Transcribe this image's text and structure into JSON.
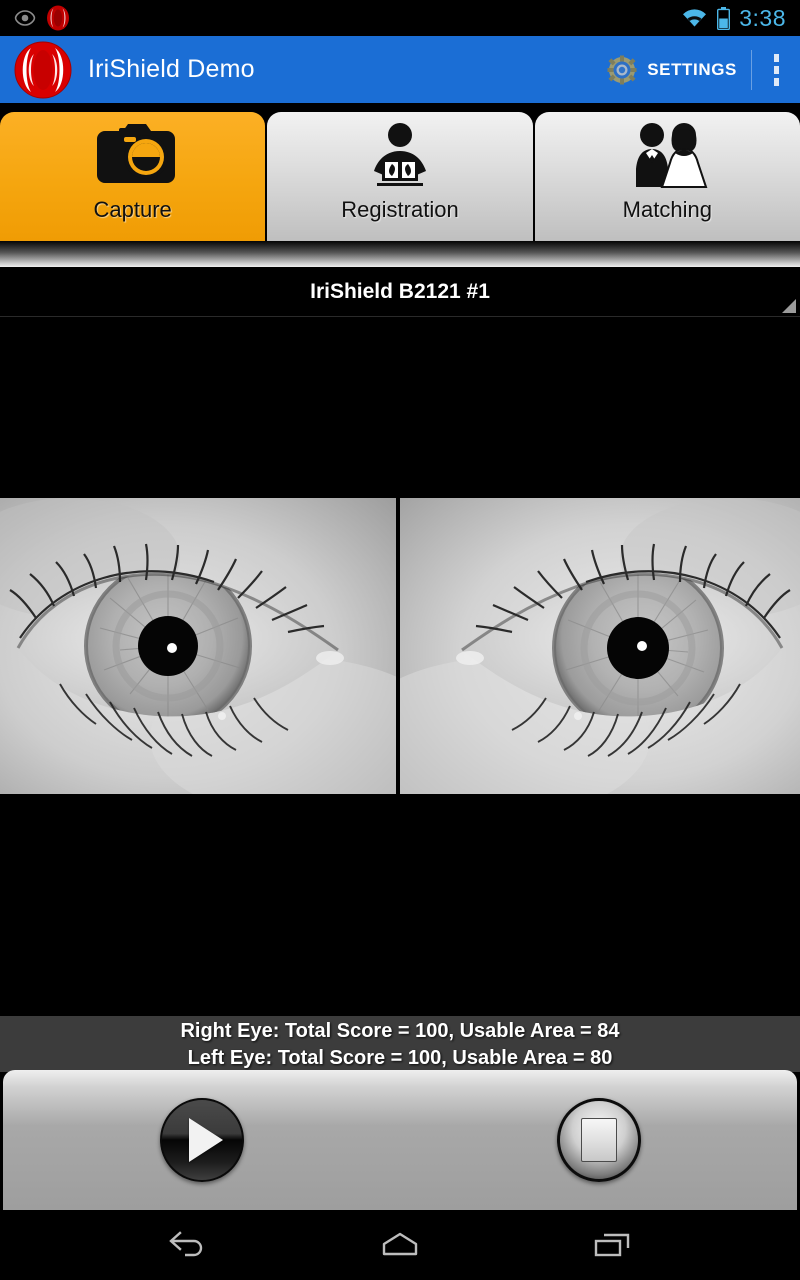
{
  "statusbar": {
    "time": "3:38",
    "icons": [
      "eye-notification-icon",
      "irishield-notification-icon",
      "wifi-icon",
      "battery-icon"
    ]
  },
  "actionbar": {
    "app_logo": "irishield-logo-icon",
    "title": "IriShield Demo",
    "settings_label": "SETTINGS",
    "settings_icon": "gear-icon",
    "overflow_icon": "overflow-menu-icon",
    "background_color": "#1b6ed5"
  },
  "tabs": [
    {
      "label": "Capture",
      "icon": "camera-icon",
      "active": true,
      "accent_color": "#f5a60f"
    },
    {
      "label": "Registration",
      "icon": "person-reading-book-icon",
      "active": false
    },
    {
      "label": "Matching",
      "icon": "bride-and-groom-icon",
      "active": false
    }
  ],
  "device_selector": {
    "value": "IriShield B2121 #1",
    "caret_icon": "spinner-caret-icon"
  },
  "preview": {
    "right_eye_image": "iris-capture-right-eye",
    "left_eye_image": "iris-capture-left-eye"
  },
  "scores": {
    "right_eye": "Right Eye: Total Score = 100, Usable Area = 84",
    "left_eye": "Left Eye: Total Score = 100, Usable Area = 80",
    "background_color": "#3c3c3c"
  },
  "controls": {
    "play_icon": "play-icon",
    "stop_icon": "stop-icon"
  },
  "navbar": {
    "back_icon": "back-icon",
    "home_icon": "home-icon",
    "recents_icon": "recents-icon"
  }
}
